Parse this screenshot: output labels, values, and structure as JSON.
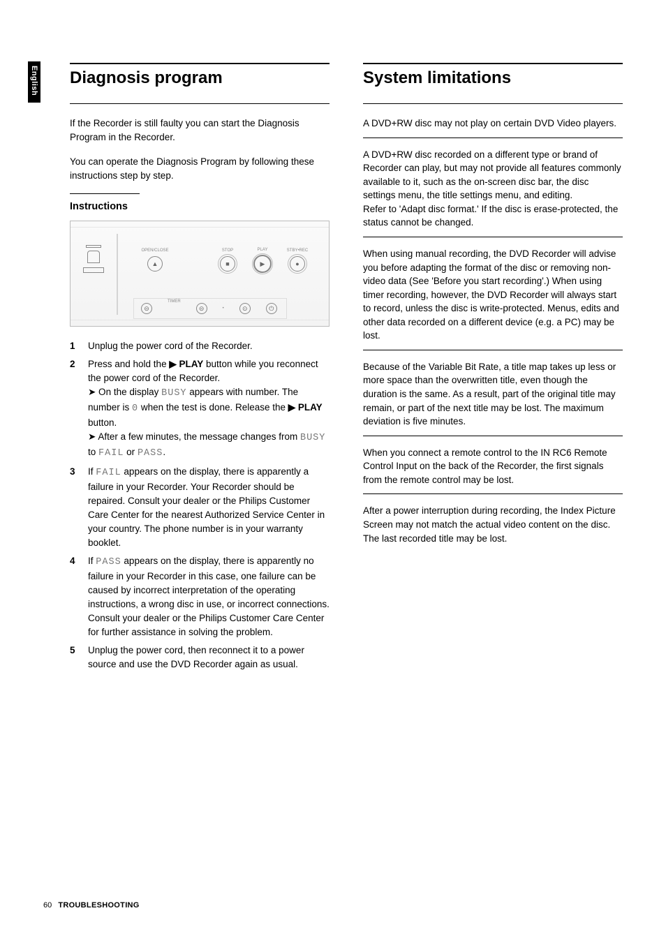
{
  "sideTab": "English",
  "left": {
    "heading": "Diagnosis program",
    "intro1": "If the Recorder is still faulty you can start the Diagnosis Program in the Recorder.",
    "intro2": "You can operate the Diagnosis Program by following these instructions step by step.",
    "subheading": "Instructions",
    "device": {
      "openclose": "OPEN/CLOSE",
      "stop": "STOP",
      "play": "PLAY",
      "stbyrec": "STBY•REC",
      "timer": "TIMER"
    },
    "steps": {
      "s1": "Unplug the power cord of the Recorder.",
      "s2_a": "Press and hold the ",
      "s2_play": "▶ PLAY",
      "s2_b": " button while you reconnect the power cord of the Recorder.",
      "s2_sub1_a": "➤ On the display ",
      "s2_sub1_busy": "BUSY",
      "s2_sub1_b": " appears with number.  The number is ",
      "s2_sub1_zero": "0",
      "s2_sub1_c": " when the test is done. Release the ",
      "s2_sub1_play": "▶ PLAY",
      "s2_sub1_d": " button.",
      "s2_sub2_a": "➤ After a few minutes, the message changes from ",
      "s2_sub2_busy": "BUSY",
      "s2_sub2_b": " to ",
      "s2_sub2_fail": "FAIL",
      "s2_sub2_c": " or ",
      "s2_sub2_pass": "PASS",
      "s2_sub2_d": ".",
      "s3_a": "If ",
      "s3_fail": "FAIL",
      "s3_b": " appears on the display, there is apparently a failure in your Recorder. Your Recorder should be repaired. Consult your dealer or the Philips Customer Care Center for the nearest Authorized Service Center in your country. The phone number is in your warranty booklet.",
      "s4_a": "If ",
      "s4_pass": "PASS",
      "s4_b": " appears on the display, there is apparently no failure in your Recorder in this case, one failure can be caused by incorrect interpretation of the operating instructions, a wrong disc in use, or incorrect connections. Consult your dealer or the Philips Customer Care Center for further assistance in solving the problem.",
      "s5": "Unplug the power cord, then reconnect it to a power source and use the DVD Recorder again as usual."
    }
  },
  "right": {
    "heading": "System limitations",
    "p1": "A DVD+RW disc may not play on certain DVD Video players.",
    "p2": "A DVD+RW disc recorded on a different type or brand of Recorder can play, but may not provide all features commonly available to it, such as the on-screen disc bar, the disc settings menu, the title settings menu, and editing.\nRefer to 'Adapt disc format.' If the disc is erase-protected, the status cannot be changed.",
    "p3": "When using manual recording, the DVD Recorder will advise you before adapting the format of the disc or removing non-video data (See 'Before you start recording'.) When using timer recording, however, the DVD Recorder will always start to record, unless the disc is write-protected. Menus, edits and other data recorded on a different device (e.g. a PC) may be lost.",
    "p4": "Because of the Variable Bit Rate, a title map takes up less or more space than the overwritten title, even though the duration is the same. As a result, part of the original title may remain, or part of the next title may be lost. The maximum deviation is five minutes.",
    "p5": "When you connect a remote control to the IN RC6 Remote Control Input on the back of the Recorder, the first signals from the remote control may be lost.",
    "p6": "After a power interruption during recording, the Index Picture Screen may not match the actual video content on the disc. The last recorded title may be lost."
  },
  "footer": {
    "page": "60",
    "section": "TROUBLESHOOTING"
  }
}
